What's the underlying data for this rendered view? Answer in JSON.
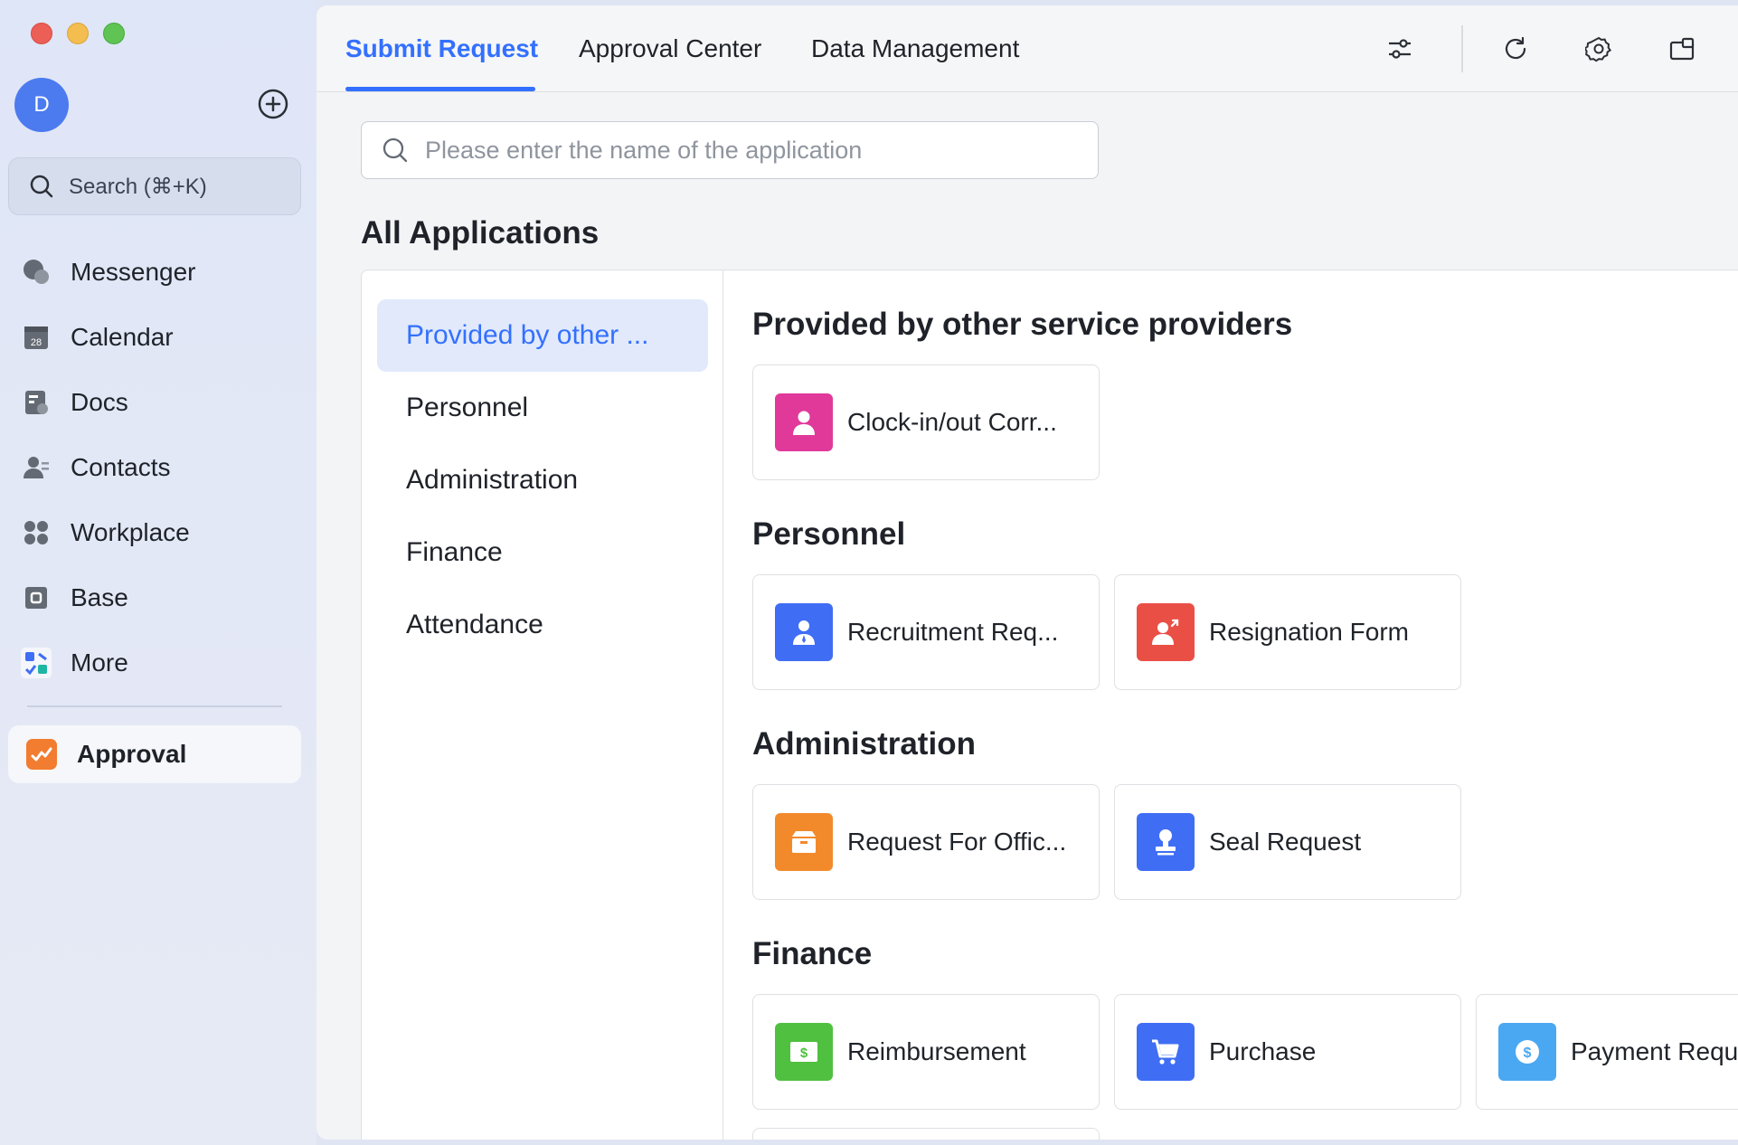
{
  "window": {
    "controls": [
      "close",
      "minimize",
      "zoom"
    ]
  },
  "sidebar": {
    "avatar_initial": "D",
    "search_label": "Search (⌘+K)",
    "items": [
      {
        "label": "Messenger",
        "icon": "messenger-icon"
      },
      {
        "label": "Calendar",
        "icon": "calendar-icon",
        "icon_text": "28"
      },
      {
        "label": "Docs",
        "icon": "docs-icon"
      },
      {
        "label": "Contacts",
        "icon": "contacts-icon"
      },
      {
        "label": "Workplace",
        "icon": "workplace-icon"
      },
      {
        "label": "Base",
        "icon": "base-icon"
      },
      {
        "label": "More",
        "icon": "more-icon"
      }
    ],
    "active_app": {
      "label": "Approval",
      "icon": "approval-icon",
      "color": "#f27c2f"
    }
  },
  "header": {
    "tabs": [
      {
        "label": "Submit Request",
        "active": true
      },
      {
        "label": "Approval Center",
        "active": false
      },
      {
        "label": "Data Management",
        "active": false
      }
    ],
    "accent_color": "#3370ff",
    "toolbar_icons": [
      "filter-sliders-icon",
      "refresh-icon",
      "settings-gear-icon",
      "new-window-icon"
    ]
  },
  "main": {
    "search_placeholder": "Please enter the name of the application",
    "title": "All Applications",
    "categories": [
      {
        "label": "Provided by other ...",
        "active": true
      },
      {
        "label": "Personnel",
        "active": false
      },
      {
        "label": "Administration",
        "active": false
      },
      {
        "label": "Finance",
        "active": false
      },
      {
        "label": "Attendance",
        "active": false
      }
    ],
    "groups": [
      {
        "title": "Provided by other service providers",
        "apps": [
          {
            "label": "Clock-in/out Corr...",
            "icon": "person-icon",
            "color": "#e0399a"
          }
        ]
      },
      {
        "title": "Personnel",
        "apps": [
          {
            "label": "Recruitment Req...",
            "icon": "person-badge-icon",
            "color": "#3f6ef5"
          },
          {
            "label": "Resignation Form",
            "icon": "person-exit-icon",
            "color": "#ea4f46"
          }
        ]
      },
      {
        "title": "Administration",
        "apps": [
          {
            "label": "Request For Offic...",
            "icon": "box-icon",
            "color": "#f28a2b"
          },
          {
            "label": "Seal Request",
            "icon": "stamp-icon",
            "color": "#3f6ef5"
          }
        ]
      },
      {
        "title": "Finance",
        "apps": [
          {
            "label": "Reimbursement",
            "icon": "cash-icon",
            "color": "#4fc03f",
            "symbol": "$"
          },
          {
            "label": "Purchase",
            "icon": "cart-icon",
            "color": "#3f6ef5"
          },
          {
            "label": "Payment Requ",
            "icon": "coin-icon",
            "color": "#4aa8f2",
            "symbol": "$"
          }
        ]
      }
    ]
  }
}
